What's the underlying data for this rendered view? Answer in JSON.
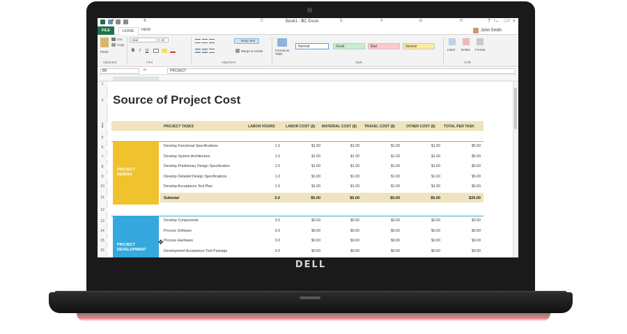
{
  "device": {
    "brand": "DELL"
  },
  "window": {
    "title": "Book1 - SC Excel",
    "controls": [
      "?",
      "–",
      "□",
      "×"
    ]
  },
  "tabs": {
    "file": "FILE",
    "home": "HOME",
    "view": "VIEW"
  },
  "user": {
    "name": "John Smith"
  },
  "ribbon": {
    "clipboard": {
      "label": "Clipboard",
      "paste": "Paste",
      "cut": "Cut",
      "copy": "Copy"
    },
    "font": {
      "label": "Font",
      "name": "Arial",
      "size": "10"
    },
    "alignment": {
      "label": "Alignment",
      "wrap": "Wrap Text",
      "merge": "Merge & Center"
    },
    "styles": {
      "label": "Style",
      "format_as_table": "Format as Table",
      "cells": [
        {
          "name": "Normal",
          "bg": "#ffffff",
          "border": "#5b9bd5"
        },
        {
          "name": "Good",
          "bg": "#c6efce",
          "border": "#c6c6c6"
        },
        {
          "name": "Bad",
          "bg": "#ffc7ce",
          "border": "#c6c6c6"
        },
        {
          "name": "Neutral",
          "bg": "#ffeb9c",
          "border": "#c6c6c6"
        }
      ]
    },
    "cells": {
      "label": "Cells",
      "insert": "Insert",
      "delete": "Delete",
      "format": "Format"
    }
  },
  "formula_bar": {
    "name_box": "B8",
    "fx": "fx",
    "value": "PROJECT"
  },
  "columns": [
    "A",
    "B",
    "C",
    "D",
    "E",
    "F",
    "G",
    "H",
    "I",
    "J",
    "K"
  ],
  "rows": [
    "1",
    "2",
    "3",
    "4",
    "5",
    "6",
    "7",
    "8",
    "9",
    "10",
    "11",
    "12",
    "13",
    "14",
    "15",
    "16"
  ],
  "sheet": {
    "title": "Source of Project Cost",
    "headers": [
      "PROJECT TASKS",
      "LABOR HOURS",
      "LABOR COST ($)",
      "MATERIAL COST ($)",
      "TRAVEL COST ($)",
      "OTHER COST ($)",
      "TOTAL PER TASK"
    ],
    "groups": [
      {
        "category": [
          "PROJECT",
          "DESIGN"
        ],
        "color": "#f0c22e",
        "tasks": [
          {
            "name": "Develop Functional Specifications",
            "values": [
              "1.0",
              "$1.00",
              "$1.00",
              "$1.00",
              "$1.00",
              "$5.00"
            ]
          },
          {
            "name": "Develop System Architecture",
            "values": [
              "1.0",
              "$1.00",
              "$1.00",
              "$1.00",
              "$1.00",
              "$5.00"
            ]
          },
          {
            "name": "Develop Preliminary Design Specification",
            "values": [
              "1.0",
              "$1.00",
              "$1.00",
              "$1.00",
              "$1.00",
              "$5.00"
            ]
          },
          {
            "name": "Develop Detailed Design Specifications",
            "values": [
              "1.0",
              "$1.00",
              "$1.00",
              "$1.00",
              "$1.00",
              "$5.00"
            ]
          },
          {
            "name": "Develop Acceptance Test Plan",
            "values": [
              "1.0",
              "$1.00",
              "$1.00",
              "$1.00",
              "$1.00",
              "$5.00"
            ]
          }
        ],
        "subtotal": {
          "label": "Subtotal",
          "values": [
            "5.0",
            "$5.00",
            "$5.00",
            "$5.00",
            "$5.00",
            "$25.00"
          ]
        }
      },
      {
        "category": [
          "PROJECT",
          "DEVELOPMENT"
        ],
        "color": "#35a8de",
        "tasks": [
          {
            "name": "Develop Components",
            "values": [
              "0.0",
              "$0.00",
              "$0.00",
              "$0.00",
              "$0.00",
              "$0.00"
            ]
          },
          {
            "name": "Procure Software",
            "values": [
              "0.0",
              "$0.00",
              "$0.00",
              "$0.00",
              "$0.00",
              "$0.00"
            ]
          },
          {
            "name": "Procure Hardware",
            "values": [
              "0.0",
              "$0.00",
              "$0.00",
              "$0.00",
              "$0.00",
              "$0.00"
            ]
          },
          {
            "name": "Development Acceptance Test Package",
            "values": [
              "0.0",
              "$0.00",
              "$0.00",
              "$0.00",
              "$0.00",
              "$0.00"
            ]
          }
        ]
      }
    ]
  }
}
